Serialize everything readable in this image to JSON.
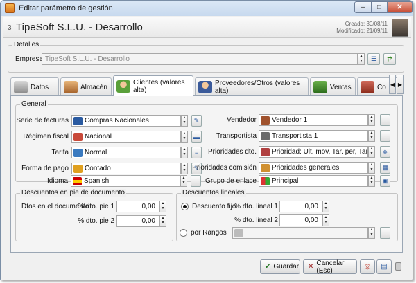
{
  "window": {
    "title": "Editar parámetro de gestión",
    "min": "–",
    "max": "□",
    "close": "✕"
  },
  "header": {
    "number": "3",
    "title": "TipeSoft S.L.U. - Desarrollo",
    "created_label": "Creado:",
    "created": "30/08/11",
    "modified_label": "Modificado:",
    "modified": "21/09/11"
  },
  "detalles": {
    "legend": "Detalles",
    "empresa_label": "Empresa",
    "empresa_value": "TipeSoft S.L.U. - Desarrollo"
  },
  "tabs": [
    {
      "label": "Datos"
    },
    {
      "label": "Almacén"
    },
    {
      "label": "Clientes (valores alta)"
    },
    {
      "label": "Proveedores/Otros (valores alta)"
    },
    {
      "label": "Ventas"
    },
    {
      "label": "Co"
    }
  ],
  "general": {
    "legend": "General",
    "left": [
      {
        "label": "Serie de facturas",
        "value": "Compras Nacionales"
      },
      {
        "label": "Régimen fiscal",
        "value": "Nacional"
      },
      {
        "label": "Tarifa",
        "value": "Normal"
      },
      {
        "label": "Forma de pago",
        "value": "Contado"
      },
      {
        "label": "Idioma",
        "value": "Spanish"
      }
    ],
    "right": [
      {
        "label": "Vendedor",
        "value": "Vendedor 1"
      },
      {
        "label": "Transportista",
        "value": "Transportista 1"
      },
      {
        "label": "Prioridades dto.",
        "value": "Prioridad: Ult. mov, Tar. per, Tarifa, E"
      },
      {
        "label": "Prioridades comisión",
        "value": "Prioridades generales"
      },
      {
        "label": "Grupo de enlace",
        "value": "Principal"
      }
    ]
  },
  "descuentos_pie": {
    "legend": "Descuentos en pie de documento",
    "row_label": "Dtos en el documento",
    "pie1_label": "% dto. pie 1",
    "pie1": "0,00",
    "pie2_label": "% dto. pie 2",
    "pie2": "0,00"
  },
  "descuentos_lineales": {
    "legend": "Descuentos lineales",
    "fijo_label": "Descuento fijo",
    "lineal1_label": "% dto. lineal 1",
    "lineal1": "0,00",
    "lineal2_label": "% dto. lineal 2",
    "lineal2": "0,00",
    "rangos_label": "por Rangos",
    "selected": "Descuento fijo"
  },
  "buttons": {
    "save": "Guardar",
    "cancel": "Cancelar (Esc)"
  },
  "colors": {
    "accent": "#2a5aa0",
    "title_bar": "#c7d9ee",
    "close": "#c74b33"
  }
}
